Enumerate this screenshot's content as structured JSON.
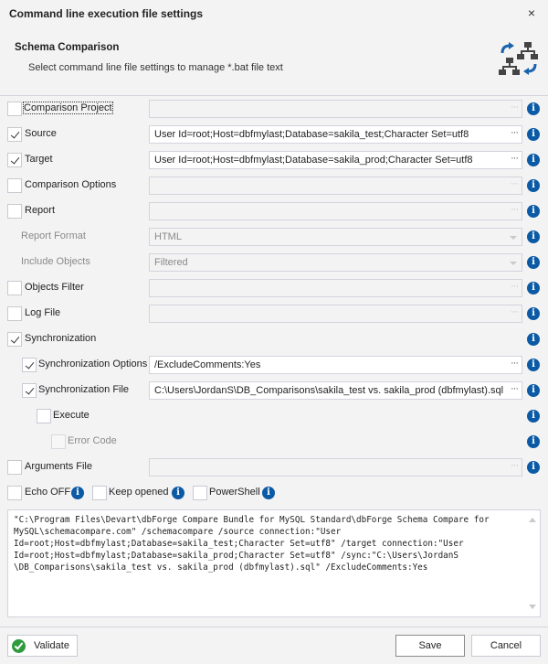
{
  "window": {
    "title": "Command line execution file settings",
    "close_label": "×"
  },
  "header": {
    "title": "Schema Comparison",
    "subtitle": "Select command line file settings to manage *.bat file text",
    "icon": "schema-sync-icon"
  },
  "options": [
    {
      "id": "comparison-project",
      "label": "Comparison Project",
      "checked": false,
      "value": "",
      "control": "browse",
      "enabled": false
    },
    {
      "id": "source",
      "label": "Source",
      "checked": true,
      "value": "User Id=root;Host=dbfmylast;Database=sakila_test;Character Set=utf8",
      "control": "browse",
      "enabled": true
    },
    {
      "id": "target",
      "label": "Target",
      "checked": true,
      "value": "User Id=root;Host=dbfmylast;Database=sakila_prod;Character Set=utf8",
      "control": "browse",
      "enabled": true
    },
    {
      "id": "comparison-options",
      "label": "Comparison Options",
      "checked": false,
      "value": "",
      "control": "browse",
      "enabled": false
    },
    {
      "id": "report",
      "label": "Report",
      "checked": false,
      "value": "",
      "control": "browse",
      "enabled": false
    },
    {
      "id": "report-format",
      "label": "Report Format",
      "value": "HTML",
      "control": "dropdown",
      "enabled": false
    },
    {
      "id": "include-objects",
      "label": "Include Objects",
      "value": "Filtered",
      "control": "dropdown",
      "enabled": false
    },
    {
      "id": "objects-filter",
      "label": "Objects Filter",
      "checked": false,
      "value": "",
      "control": "browse",
      "enabled": false
    },
    {
      "id": "log-file",
      "label": "Log File",
      "checked": false,
      "value": "",
      "control": "browse",
      "enabled": false
    },
    {
      "id": "synchronization",
      "label": "Synchronization",
      "checked": true
    },
    {
      "id": "synchronization-options",
      "label": "Synchronization Options",
      "checked": true,
      "value": "/ExcludeComments:Yes",
      "control": "browse",
      "enabled": true
    },
    {
      "id": "synchronization-file",
      "label": "Synchronization File",
      "checked": true,
      "value": "C:\\Users\\JordanS\\DB_Comparisons\\sakila_test vs. sakila_prod (dbfmylast).sql",
      "control": "browse",
      "enabled": true
    },
    {
      "id": "execute",
      "label": "Execute",
      "checked": false
    },
    {
      "id": "error-code",
      "label": "Error Code",
      "checked": false,
      "enabled": false
    },
    {
      "id": "arguments-file",
      "label": "Arguments File",
      "checked": false,
      "value": "",
      "control": "browse",
      "enabled": false
    }
  ],
  "flags": [
    {
      "id": "echo-off",
      "label": "Echo OFF",
      "checked": false
    },
    {
      "id": "keep-opened",
      "label": "Keep opened",
      "checked": false
    },
    {
      "id": "powershell",
      "label": "PowerShell",
      "checked": false
    }
  ],
  "command_text": "\"C:\\Program Files\\Devart\\dbForge Compare Bundle for MySQL Standard\\dbForge Schema Compare for\nMySQL\\schemacompare.com\" /schemacompare /source connection:\"User\nId=root;Host=dbfmylast;Database=sakila_test;Character Set=utf8\" /target connection:\"User\nId=root;Host=dbfmylast;Database=sakila_prod;Character Set=utf8\" /sync:\"C:\\Users\\JordanS\n\\DB_Comparisons\\sakila_test vs. sakila_prod (dbfmylast).sql\" /ExcludeComments:Yes",
  "footer": {
    "validate_label": "Validate",
    "save_label": "Save",
    "cancel_label": "Cancel"
  },
  "colors": {
    "info_icon": "#0b5aa5",
    "validate_icon": "#2f9a3e",
    "background": "#f3f3f3"
  }
}
